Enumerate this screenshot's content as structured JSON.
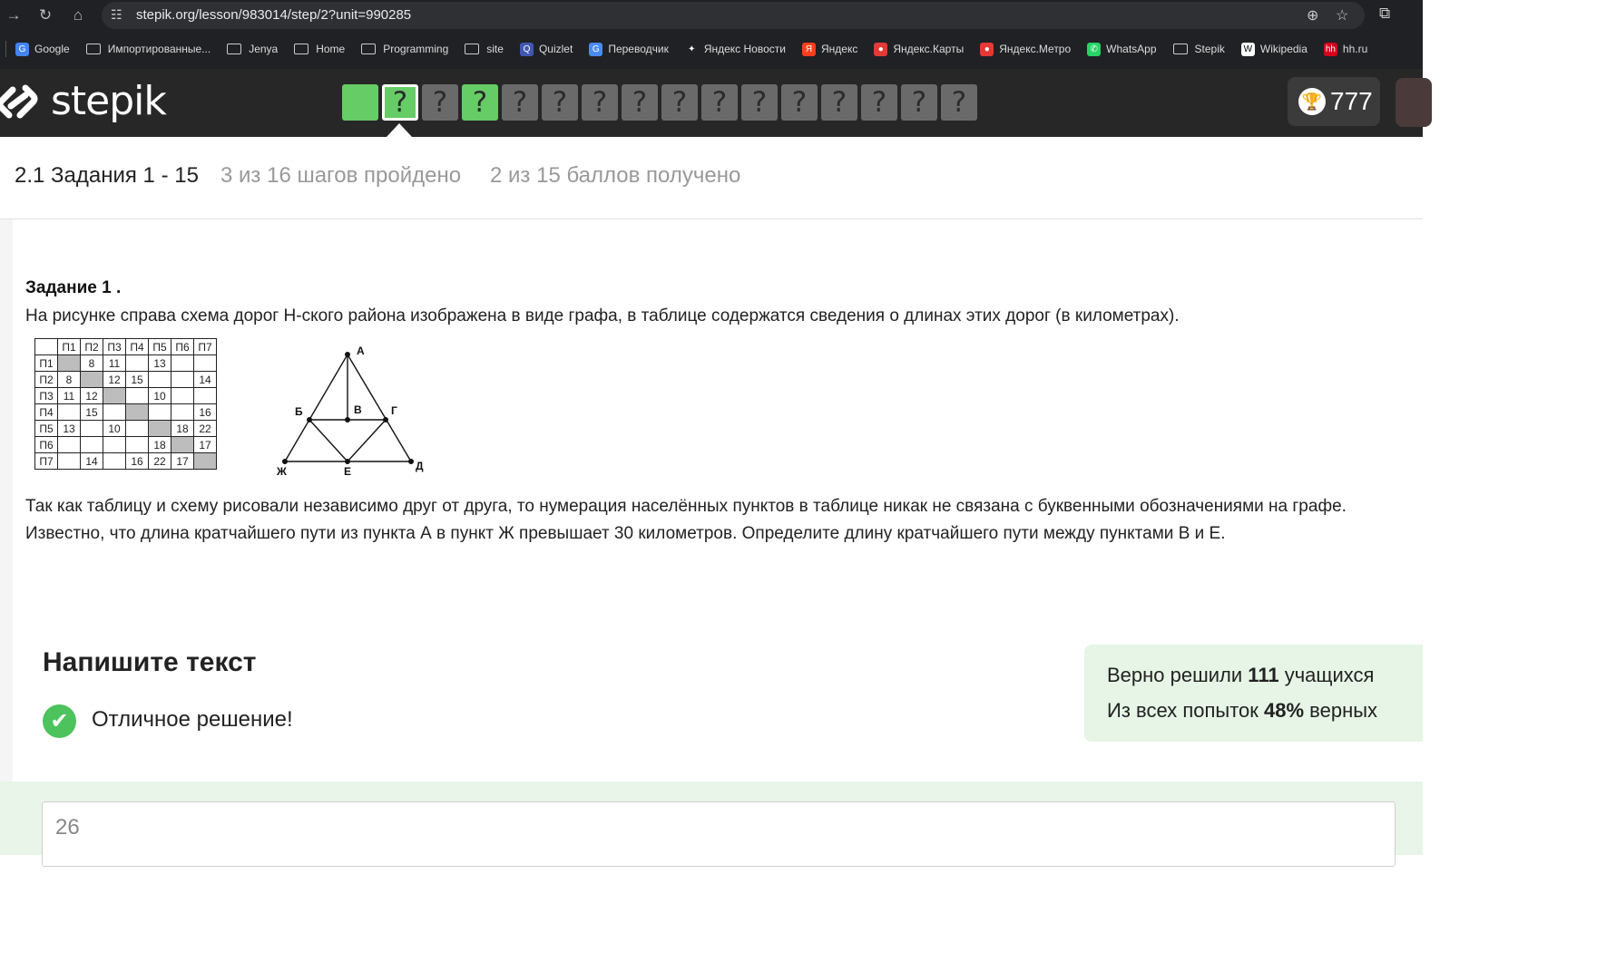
{
  "browser": {
    "url": "stepik.org/lesson/983014/step/2?unit=990285",
    "bookmarks": [
      {
        "label": "Google",
        "icon": "google-icon",
        "color": "#4285f4",
        "glyph": "G"
      },
      {
        "label": "Импортированные...",
        "icon": "folder-icon"
      },
      {
        "label": "Jenya",
        "icon": "folder-icon"
      },
      {
        "label": "Home",
        "icon": "folder-icon"
      },
      {
        "label": "Programming",
        "icon": "folder-icon"
      },
      {
        "label": "site",
        "icon": "folder-icon"
      },
      {
        "label": "Quizlet",
        "icon": "quizlet-icon",
        "color": "#4257b2",
        "glyph": "Q"
      },
      {
        "label": "Переводчик",
        "icon": "translate-icon",
        "color": "#4a8af4",
        "glyph": "G"
      },
      {
        "label": "Яндекс Новости",
        "icon": "news-icon",
        "color": "#202124",
        "glyph": "✦"
      },
      {
        "label": "Яндекс",
        "icon": "yandex-icon",
        "color": "#fc3f1d",
        "glyph": "Я"
      },
      {
        "label": "Яндекс.Карты",
        "icon": "map-pin-icon",
        "color": "#e53935",
        "glyph": "●"
      },
      {
        "label": "Яндекс.Метро",
        "icon": "metro-icon",
        "color": "#e53935",
        "glyph": "●"
      },
      {
        "label": "WhatsApp",
        "icon": "whatsapp-icon",
        "color": "#25d366",
        "glyph": "✆"
      },
      {
        "label": "Stepik",
        "icon": "folder-icon"
      },
      {
        "label": "Wikipedia",
        "icon": "wikipedia-icon",
        "color": "#ffffff",
        "glyph": "W"
      },
      {
        "label": "hh.ru",
        "icon": "hh-icon",
        "color": "#d6001c",
        "glyph": "hh"
      }
    ]
  },
  "header": {
    "logo_text": "stepik",
    "steps": [
      {
        "state": "done",
        "label": ""
      },
      {
        "state": "current",
        "label": "?"
      },
      {
        "state": "todo",
        "label": "?"
      },
      {
        "state": "done",
        "label": "?"
      },
      {
        "state": "todo",
        "label": "?"
      },
      {
        "state": "todo",
        "label": "?"
      },
      {
        "state": "todo",
        "label": "?"
      },
      {
        "state": "todo",
        "label": "?"
      },
      {
        "state": "todo",
        "label": "?"
      },
      {
        "state": "todo",
        "label": "?"
      },
      {
        "state": "todo",
        "label": "?"
      },
      {
        "state": "todo",
        "label": "?"
      },
      {
        "state": "todo",
        "label": "?"
      },
      {
        "state": "todo",
        "label": "?"
      },
      {
        "state": "todo",
        "label": "?"
      },
      {
        "state": "todo",
        "label": "?"
      }
    ],
    "score": "777",
    "colors": {
      "done": "#66cc66",
      "todo": "#6a6a6a",
      "bar": "#272727"
    }
  },
  "lesson": {
    "title": "2.1 Задания 1 - 15",
    "progress": "3 из 16 шагов пройдено",
    "score": "2 из 15 баллов  получено"
  },
  "task": {
    "heading": "Задание 1 .",
    "intro": "На рисунке справа схема дорог Н-ского района изображена в виде графа, в таблице содержатся сведения о длинах этих дорог (в километрах).",
    "table": {
      "headers": [
        "",
        "П1",
        "П2",
        "П3",
        "П4",
        "П5",
        "П6",
        "П7"
      ],
      "rows": [
        [
          "П1",
          "#",
          "8",
          "11",
          "",
          "13",
          "",
          ""
        ],
        [
          "П2",
          "8",
          "#",
          "12",
          "15",
          "",
          "",
          "14"
        ],
        [
          "П3",
          "11",
          "12",
          "#",
          "",
          "10",
          "",
          ""
        ],
        [
          "П4",
          "",
          "15",
          "",
          "#",
          "",
          "",
          "16"
        ],
        [
          "П5",
          "13",
          "",
          "10",
          "",
          "#",
          "18",
          "22"
        ],
        [
          "П6",
          "",
          "",
          "",
          "",
          "18",
          "#",
          "17"
        ],
        [
          "П7",
          "",
          "14",
          "",
          "16",
          "22",
          "17",
          "#"
        ]
      ]
    },
    "graph_labels": {
      "A": "А",
      "B": "Б",
      "V": "В",
      "G": "Г",
      "Zh": "Ж",
      "E": "Е",
      "D": "Д"
    },
    "body": "Так как таблицу и схему рисовали независимо друг от друга, то нумерация населённых пунктов в таблице никак не связана с буквенными обозначениями на графе. Известно, что длина кратчайшего пути из пункта А в пункт Ж превышает 30 километров. Определите длину кратчайшего пути между пунктами В и Е."
  },
  "answer": {
    "heading": "Напишите текст",
    "status": "Отличное решение!",
    "value": "26",
    "stats_line1_pre": "Верно решили ",
    "stats_line1_num": "111",
    "stats_line1_post": " учащихся",
    "stats_line2_pre": "Из всех попыток ",
    "stats_line2_num": "48%",
    "stats_line2_post": " верных"
  }
}
